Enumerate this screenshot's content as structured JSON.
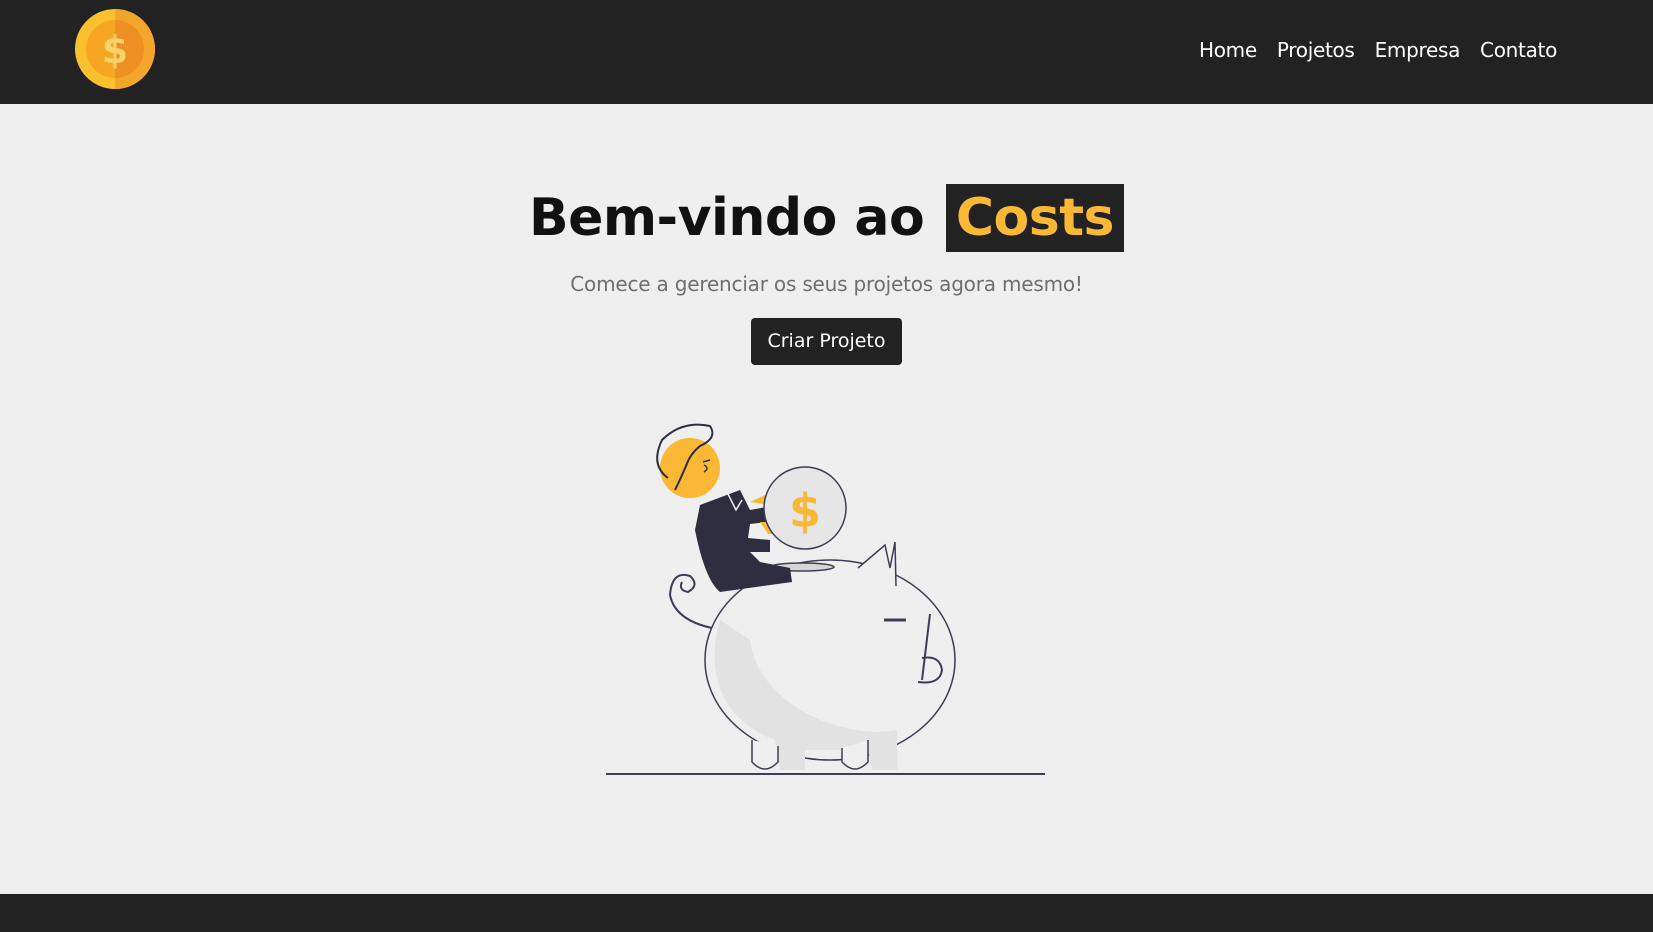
{
  "header": {
    "logo_icon": "coin-dollar-icon",
    "nav": [
      {
        "label": "Home"
      },
      {
        "label": "Projetos"
      },
      {
        "label": "Empresa"
      },
      {
        "label": "Contato"
      }
    ]
  },
  "hero": {
    "title_prefix": "Bem-vindo ao",
    "title_brand": "Costs",
    "subtitle": "Comece a gerenciar os seus projetos agora mesmo!",
    "cta_label": "Criar Projeto",
    "illustration_icon": "piggy-bank-savings-illustration"
  },
  "colors": {
    "dark": "#222222",
    "accent": "#fbb834",
    "background": "#efefef"
  }
}
